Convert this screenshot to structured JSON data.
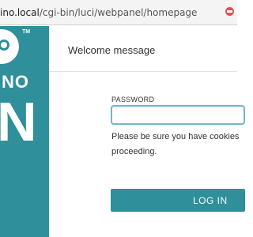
{
  "browser": {
    "url_host": "ino.local",
    "url_path": "/cgi-bin/luci/webpanel/homepage"
  },
  "sidebar": {
    "logo_tm": "TM",
    "logo_line1": "NO",
    "logo_line2": "N"
  },
  "panel": {
    "title": "Welcome message",
    "password_label": "PASSWORD",
    "password_value": "",
    "cookie_line1": "Please be sure you have cookies",
    "cookie_line2": "proceeding.",
    "login_label": "LOG IN"
  },
  "colors": {
    "brand_teal": "#2f8f9a",
    "input_focus": "#6fb7c6"
  }
}
